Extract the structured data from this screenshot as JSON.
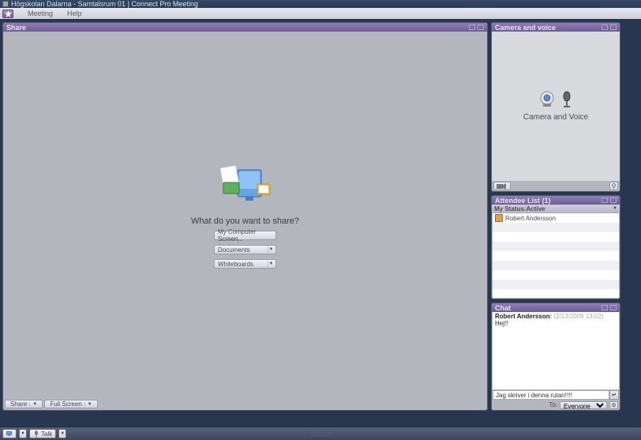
{
  "app": {
    "title": "Högskolan Dalarna - Samtalsrum 01 | Connect Pro Meeting"
  },
  "menu": {
    "items": [
      "Meeting",
      "Help"
    ]
  },
  "share": {
    "header": "Share",
    "prompt": "What do you want to share?",
    "btn_screen": "My Computer Screen...",
    "dd_documents": "Documents",
    "dd_whiteboards": "Whiteboards",
    "footer_share": "Share",
    "footer_fullscreen": "Full Screen"
  },
  "camera": {
    "header": "Camera and voice",
    "label": "Camera and Voice"
  },
  "attendees": {
    "header": "Attendee List",
    "count": "(1)",
    "status_label": "My Status:",
    "status_value": "Active",
    "list": [
      {
        "name": "Robert Andersson",
        "role": "host"
      }
    ]
  },
  "chat": {
    "header": "Chat",
    "messages": [
      {
        "sender": "Robert Andersson:",
        "time": "(2/13/2009 13:02)",
        "text": "Hej!!"
      }
    ],
    "input_value": "Jag skriver i denna rutan!!!!",
    "to_label": "To:",
    "to_value": "Everyone"
  },
  "bottombar": {
    "talk": "Talk"
  }
}
